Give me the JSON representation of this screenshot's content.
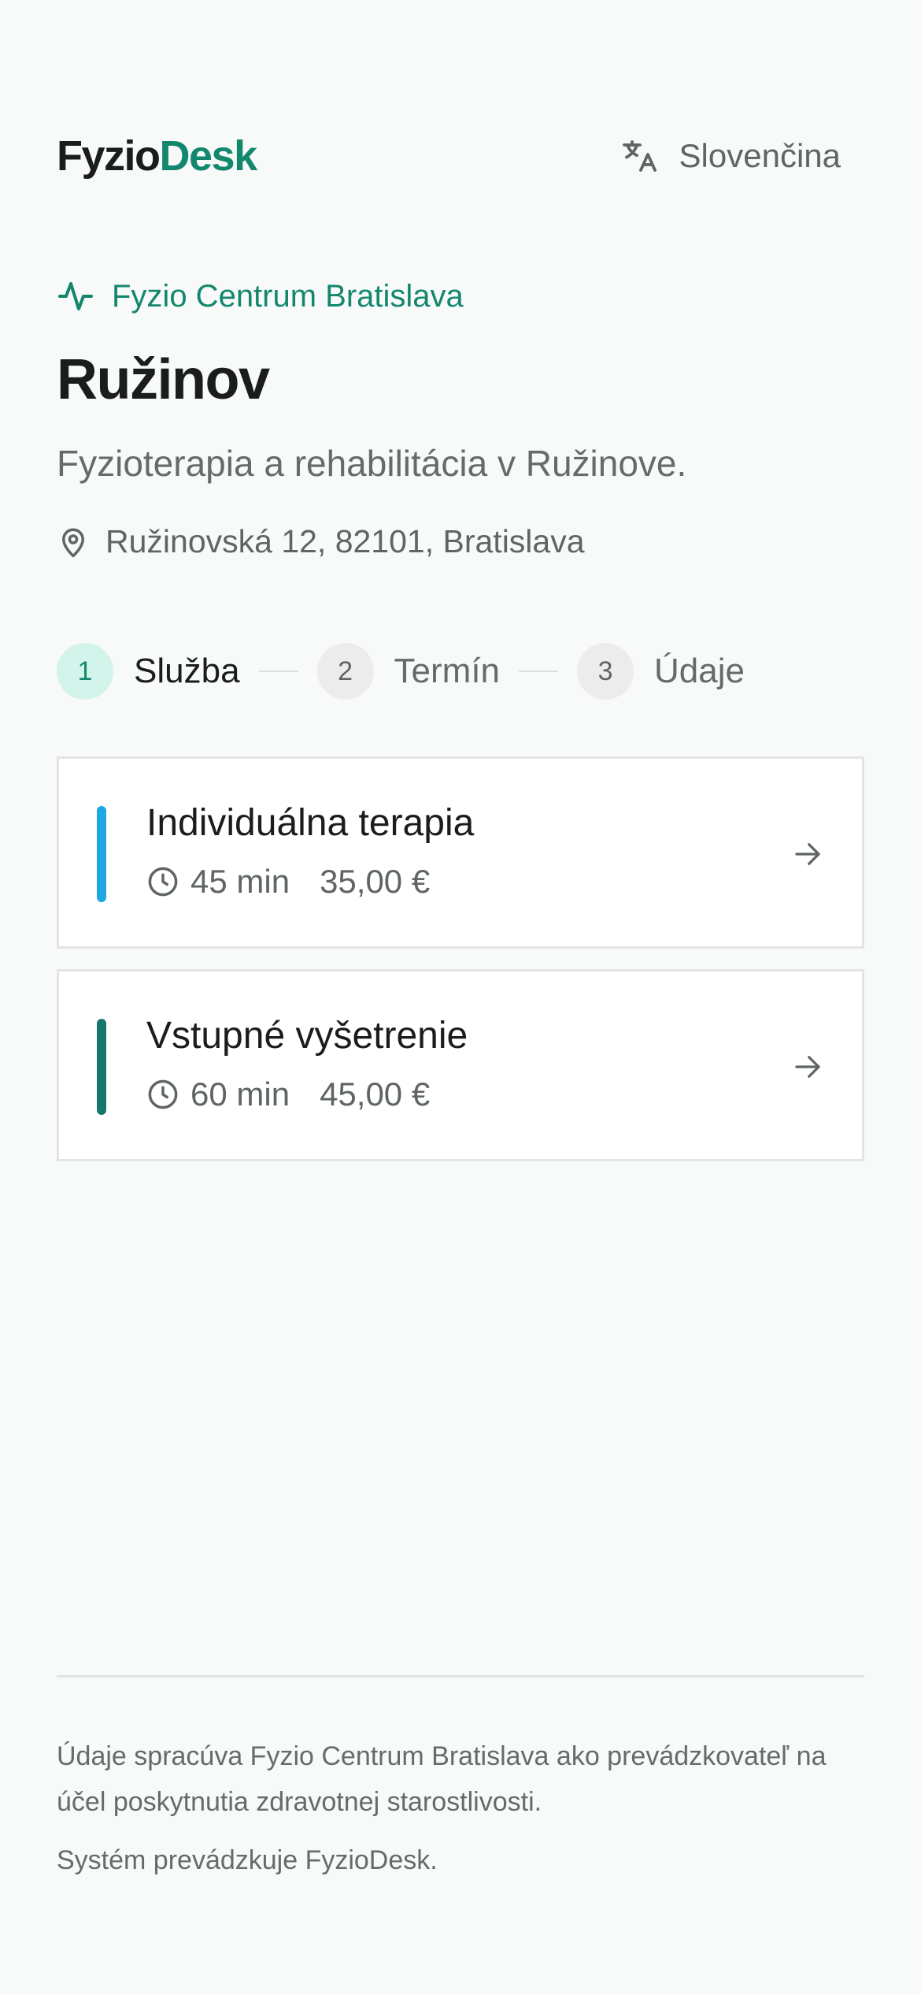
{
  "header": {
    "logo_part1": "Fyzio",
    "logo_part2": "Desk",
    "language": "Slovenčina",
    "language_icon": "translate-icon"
  },
  "clinic": {
    "organization": "Fyzio Centrum Bratislava",
    "organization_icon": "activity-pulse-icon",
    "branch_title": "Ružinov",
    "description": "Fyzioterapia a rehabilitácia v Ružinove.",
    "address": "Ružinovská 12, 82101, Bratislava",
    "address_icon": "map-pin-icon"
  },
  "stepper": {
    "steps": [
      {
        "number": "1",
        "label": "Služba",
        "state": "active"
      },
      {
        "number": "2",
        "label": "Termín",
        "state": "inactive"
      },
      {
        "number": "3",
        "label": "Údaje",
        "state": "inactive"
      }
    ]
  },
  "services": [
    {
      "name": "Individuálna terapia",
      "duration": "45 min",
      "price": "35,00 €",
      "color": "#1ea7e1"
    },
    {
      "name": "Vstupné vyšetrenie",
      "duration": "60 min",
      "price": "45,00 €",
      "color": "#17776a"
    }
  ],
  "footer": {
    "notice": "Údaje spracúva Fyzio Centrum Bratislava ako prevádzkovateľ na účel poskytnutia zdravotnej starostlivosti.",
    "operator": "Systém prevádzkuje FyzioDesk."
  },
  "colors": {
    "brand": "#13876e",
    "background": "#f8faf9",
    "active_step_bg": "#d2f4ea"
  }
}
